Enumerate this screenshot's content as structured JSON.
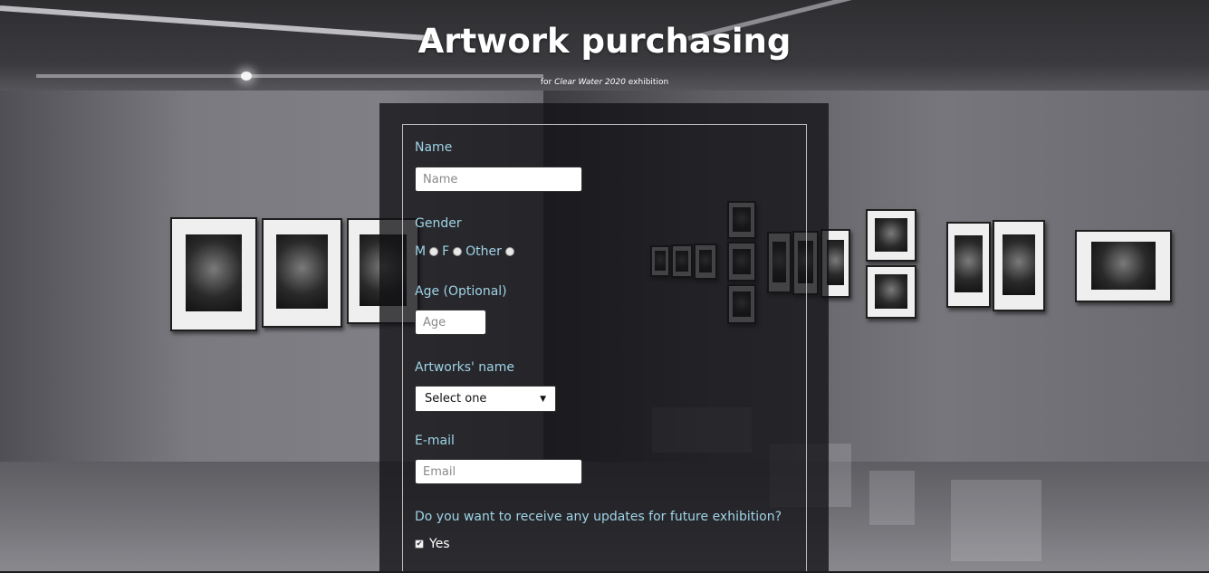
{
  "header": {
    "title": "Artwork purchasing",
    "subtitle_prefix": "for ",
    "subtitle_emphasis": "Clear Water 2020",
    "subtitle_suffix": " exhibition"
  },
  "form": {
    "name": {
      "label": "Name",
      "placeholder": "Name",
      "value": ""
    },
    "gender": {
      "label": "Gender",
      "options": [
        "M",
        "F",
        "Other"
      ],
      "selected": null
    },
    "age": {
      "label": "Age (Optional)",
      "placeholder": "Age",
      "value": ""
    },
    "artwork": {
      "label": "Artworks' name",
      "selected": "Select one"
    },
    "email": {
      "label": "E-mail",
      "placeholder": "Email",
      "value": ""
    },
    "updates": {
      "question": "Do you want to receive any updates for future exhibition?",
      "checkbox_label": "Yes",
      "checked": true
    }
  },
  "colors": {
    "label": "#9fd3e6",
    "panel": "#121216",
    "title": "#ffffff"
  }
}
